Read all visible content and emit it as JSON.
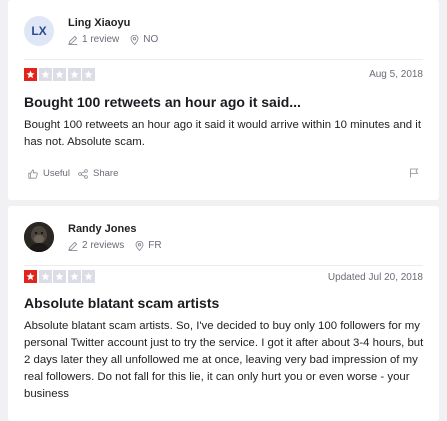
{
  "reviews": [
    {
      "initials": "LX",
      "name": "Ling Xiaoyu",
      "review_count": "1 review",
      "country": "NO",
      "rating": 1,
      "date": "Aug 5, 2018",
      "title": "Bought 100 retweets an hour ago it said...",
      "body": "Bought 100 retweets an hour ago it said it would arrive within 10 minutes and it has not. Absolute scam.",
      "useful_label": "Useful",
      "share_label": "Share"
    },
    {
      "name": "Randy Jones",
      "review_count": "2 reviews",
      "country": "FR",
      "rating": 1,
      "date": "Updated Jul 20, 2018",
      "title": "Absolute blatant scam artists",
      "body": "Absolute blatant scam artists. So, I've decided to buy only 100 followers for my personal Twitter account just to try the service. I got it after about 3-4 hours, but 2 days later they all unfollowed me at once, leaving very bad impression of my real followers. Do not fall for this lie, it can only hurt you or even worse - your business"
    }
  ],
  "colors": {
    "star_active": "#e3241b",
    "star_inactive": "#dcdce6",
    "page_background": "#f1f1f4",
    "avatar_bg": "#dfe6f6",
    "avatar_text": "#2c4a8e"
  },
  "icons": {
    "review_count": "pencil-icon",
    "location": "location-pin-icon",
    "star": "star-icon",
    "useful": "thumbs-up-icon",
    "share": "share-icon",
    "flag": "flag-icon"
  }
}
